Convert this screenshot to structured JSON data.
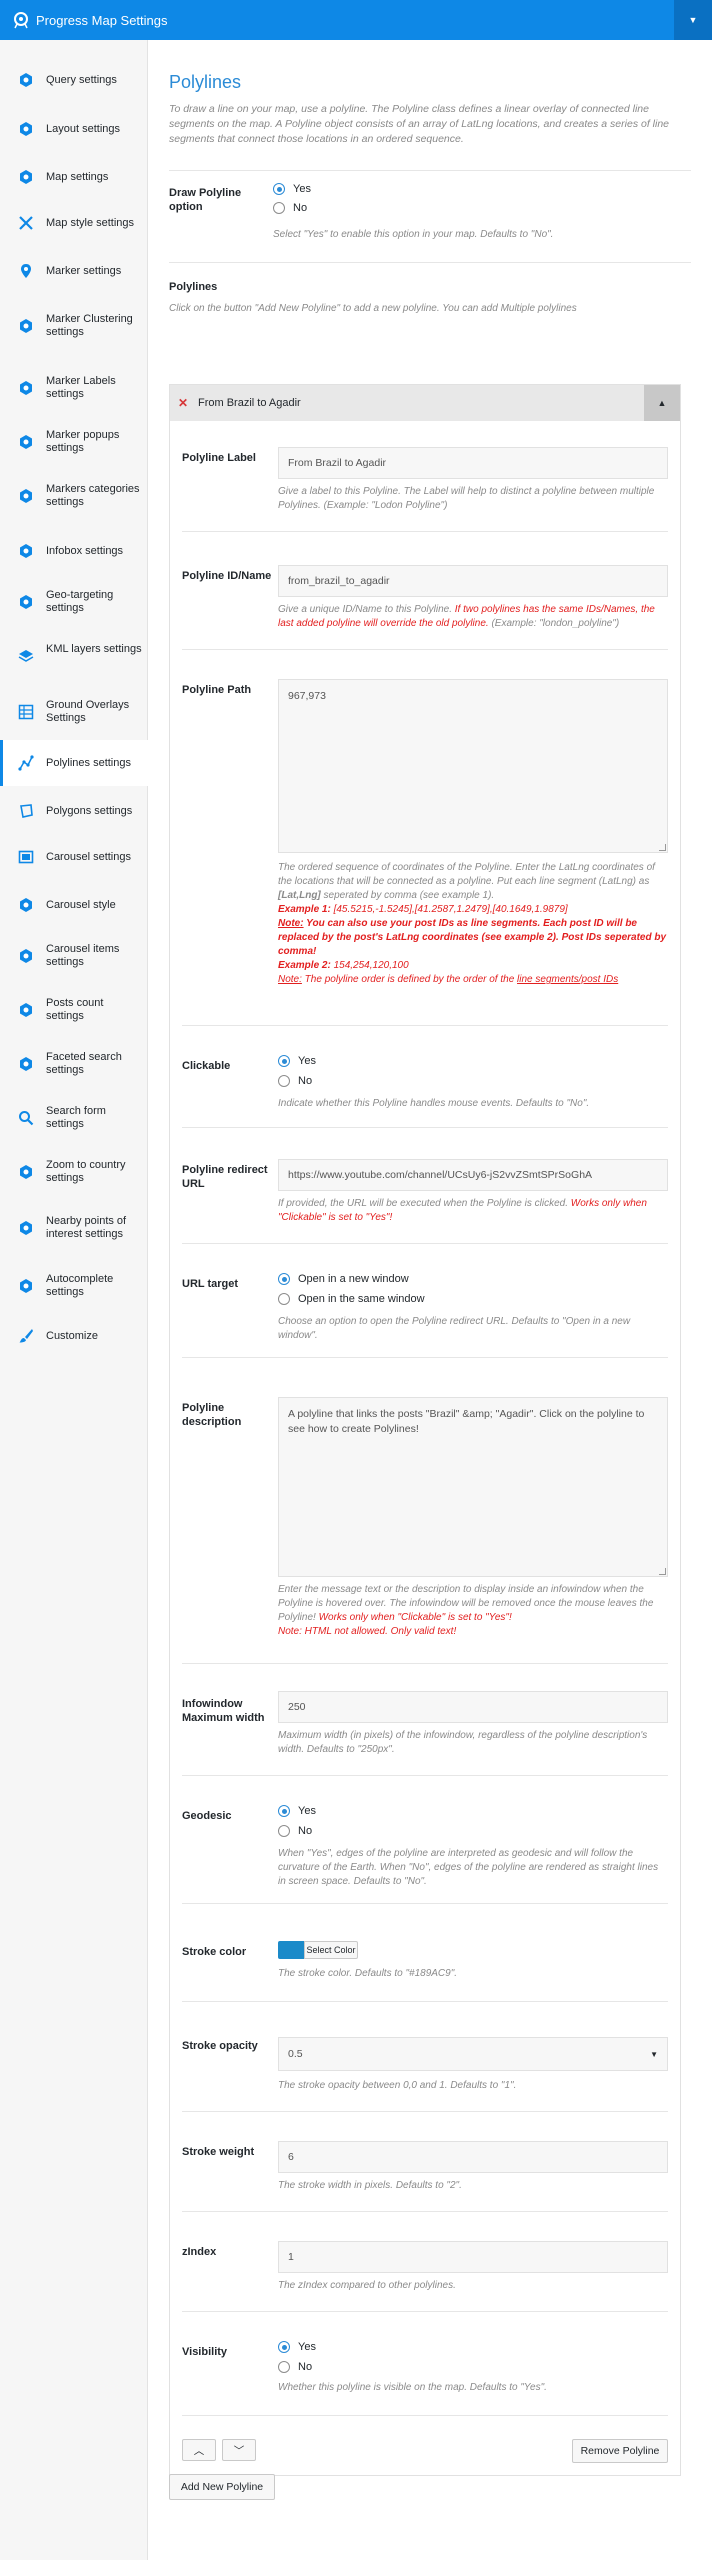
{
  "header": {
    "title": "Progress Map Settings",
    "logo_icon": "pin-logo-icon",
    "caret_icon": "caret-down-icon"
  },
  "sidebar": {
    "items": [
      {
        "label": "Query settings",
        "icon": "gear-icon"
      },
      {
        "label": "Layout settings",
        "icon": "layout-icon"
      },
      {
        "label": "Map settings",
        "icon": "gear-icon"
      },
      {
        "label": "Map style settings",
        "icon": "tools-icon"
      },
      {
        "label": "Marker settings",
        "icon": "marker-icon"
      },
      {
        "label": "Marker Clustering settings",
        "icon": "cluster-icon"
      },
      {
        "label": "Marker Labels settings",
        "icon": "label-icon"
      },
      {
        "label": "Marker popups settings",
        "icon": "popup-icon"
      },
      {
        "label": "Markers categories settings",
        "icon": "categories-icon"
      },
      {
        "label": "Infobox settings",
        "icon": "infobox-icon"
      },
      {
        "label": "Geo-targeting settings",
        "icon": "geo-icon"
      },
      {
        "label": "KML layers settings",
        "icon": "layers-icon"
      },
      {
        "label": "Ground Overlays Settings",
        "icon": "overlay-icon"
      },
      {
        "label": "Polylines settings",
        "icon": "polyline-icon"
      },
      {
        "label": "Polygons settings",
        "icon": "polygon-icon"
      },
      {
        "label": "Carousel settings",
        "icon": "carousel-icon"
      },
      {
        "label": "Carousel style",
        "icon": "carousel-style-icon"
      },
      {
        "label": "Carousel items settings",
        "icon": "carousel-items-icon"
      },
      {
        "label": "Posts count settings",
        "icon": "posts-count-icon"
      },
      {
        "label": "Faceted search settings",
        "icon": "faceted-icon"
      },
      {
        "label": "Search form settings",
        "icon": "search-icon"
      },
      {
        "label": "Zoom to country settings",
        "icon": "zoom-icon"
      },
      {
        "label": "Nearby points of interest settings",
        "icon": "nearby-icon"
      },
      {
        "label": "Autocomplete settings",
        "icon": "autocomplete-icon"
      },
      {
        "label": "Customize",
        "icon": "brush-icon"
      }
    ],
    "active_index": 13
  },
  "page": {
    "title": "Polylines",
    "intro": "To draw a line on your map, use a polyline. The Polyline class defines a linear overlay of connected line segments on the map. A Polyline object consists of an array of LatLng locations, and creates a series of line segments that connect those locations in an ordered sequence.",
    "draw": {
      "label": "Draw Polyline option",
      "yes": "Yes",
      "no": "No",
      "help": "Select \"Yes\" to enable this option in your map. Defaults to \"No\"."
    },
    "section": {
      "title": "Polylines",
      "help": "Click on the button \"Add New Polyline\" to add a new polyline. You can add Multiple polylines"
    },
    "add_button": "Add New Polyline"
  },
  "polyline": {
    "header_title": "From Brazil to Agadir",
    "label": {
      "label": "Polyline Label",
      "value": "From Brazil to Agadir",
      "help": "Give a label to this Polyline. The Label will help to distinct a polyline between multiple Polylines. (Example: \"Lodon Polyline\")"
    },
    "id": {
      "label": "Polyline ID/Name",
      "value": "from_brazil_to_agadir",
      "help_a": "Give a unique ID/Name to this Polyline. ",
      "help_red": "If two polylines has the same IDs/Names, the last added polyline will override the old polyline.",
      "help_b": " (Example: \"london_polyline\")"
    },
    "path": {
      "label": "Polyline Path",
      "value": "967,973",
      "help_1": "The ordered sequence of coordinates of the Polyline. Enter the LatLng coordinates of the locations that will be connected as a polyline. Put each line segment (LatLng) as ",
      "help_1b": "[Lat,Lng]",
      "help_1c": " seperated by comma (see example 1).",
      "ex1_label": "Example 1:",
      "ex1_value": " [45.5215,-1.5245],[41.2587,1.2479],[40.1649,1.9879]",
      "note_label": "Note:",
      "note_text": " You can also use your post IDs as line segments. Each post ID will be replaced by the post's LatLng coordinates (see example 2). Post IDs seperated by comma!",
      "ex2_label": "Example 2:",
      "ex2_value": " 154,254,120,100",
      "note2_label": "Note:",
      "note2_text": " The polyline order is defined by the order of the ",
      "note2_link": "line segments/post IDs"
    },
    "clickable": {
      "label": "Clickable",
      "yes": "Yes",
      "no": "No",
      "help": "Indicate whether this Polyline handles mouse events. Defaults to \"No\"."
    },
    "redirect": {
      "label": "Polyline redirect URL",
      "value": "https://www.youtube.com/channel/UCsUy6-jS2vvZSmtSPrSoGhA",
      "help": "If provided, the URL will be executed when the Polyline is clicked. ",
      "help_red": "Works only when \"Clickable\" is set to \"Yes\"!"
    },
    "target": {
      "label": "URL target",
      "opt1": "Open in a new window",
      "opt2": "Open in the same window",
      "help": "Choose an option to open the Polyline redirect URL. Defaults to \"Open in a new window\"."
    },
    "description": {
      "label": "Polyline description",
      "value": "A polyline that links the posts \"Brazil\" &amp; \"Agadir\". Click on the polyline to see how to create Polylines!",
      "help": "Enter the message text or the description to display inside an infowindow when the Polyline is hovered over. The infowindow will be removed once the mouse leaves the Polyline! ",
      "help_red": "Works only when \"Clickable\" is set to \"Yes\"!",
      "help_red2": "Note: HTML not allowed. Only valid text!"
    },
    "maxwidth": {
      "label": "Infowindow Maximum width",
      "value": "250",
      "help": "Maximum width (in pixels) of the infowindow, regardless of the polyline description's width. Defaults to \"250px\"."
    },
    "geodesic": {
      "label": "Geodesic",
      "yes": "Yes",
      "no": "No",
      "help": "When \"Yes\", edges of the polyline are interpreted as geodesic and will follow the curvature of the Earth. When \"No\", edges of the polyline are rendered as straight lines in screen space. Defaults to \"No\"."
    },
    "stroke_color": {
      "label": "Stroke color",
      "button": "Select Color",
      "color": "#1B8AC9",
      "help": "The stroke color. Defaults to \"#189AC9\"."
    },
    "stroke_opacity": {
      "label": "Stroke opacity",
      "value": "0.5",
      "help": "The stroke opacity between 0,0 and 1. Defaults to \"1\"."
    },
    "stroke_weight": {
      "label": "Stroke weight",
      "value": "6",
      "help": "The stroke width in pixels. Defaults to \"2\"."
    },
    "zindex": {
      "label": "zIndex",
      "value": "1",
      "help": "The zIndex compared to other polylines."
    },
    "visibility": {
      "label": "Visibility",
      "yes": "Yes",
      "no": "No",
      "help": "Whether this polyline is visible on the map. Defaults to \"Yes\"."
    },
    "remove_button": "Remove Polyline",
    "up_icon": "chevron-up-icon",
    "down_icon": "chevron-down-icon"
  },
  "colors": {
    "accent": "#0e88e6",
    "link": "#2b8bd6",
    "danger": "#e21f1f"
  }
}
